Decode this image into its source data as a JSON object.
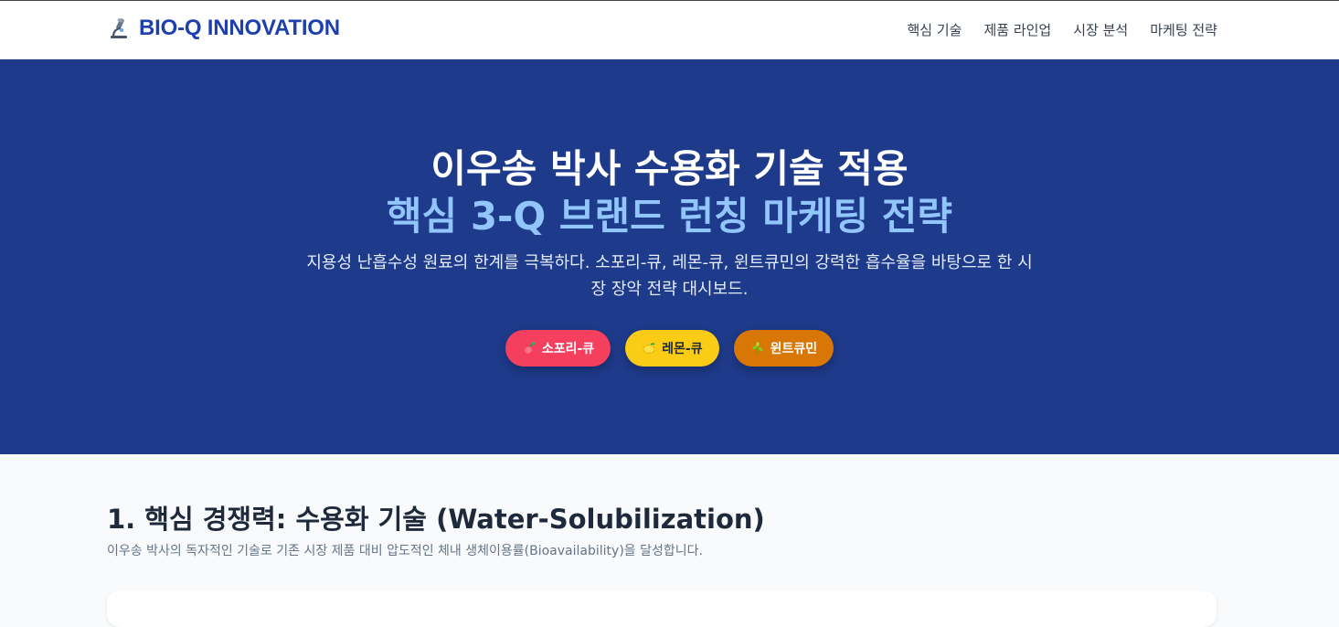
{
  "header": {
    "brand": "BIO-Q INNOVATION",
    "brand_icon": "microscope-icon",
    "nav": [
      "핵심 기술",
      "제품 라인업",
      "시장 분석",
      "마케팅 전략"
    ]
  },
  "hero": {
    "title_line1": "이우송 박사 수용화 기술 적용",
    "title_line2": "핵심 3-Q 브랜드 런칭 마케팅 전략",
    "description": "지용성 난흡수성 원료의 한계를 극복하다. 소포리-큐, 레몬-큐, 윈트큐민의 강력한 흡수율을 바탕으로 한 시장 장악 전략 대시보드.",
    "pills": [
      {
        "label": "소포리-큐",
        "icon": "sophora-icon",
        "bg": "#f43f5e",
        "fg": "#ffffff"
      },
      {
        "label": "레몬-큐",
        "icon": "lemon-icon",
        "bg": "#facc15",
        "fg": "#1f2937"
      },
      {
        "label": "윈트큐민",
        "icon": "herb-icon",
        "bg": "#d97706",
        "fg": "#ffffff"
      }
    ]
  },
  "section": {
    "title": "1. 핵심 경쟁력: 수용화 기술 (Water-Solubilization)",
    "subtitle": "이우송 박사의 독자적인 기술로 기존 시장 제품 대비 압도적인 체내 생체이용률(Bioavailability)을 달성합니다."
  },
  "colors": {
    "brand": "#1e40af",
    "hero_bg": "#1e3a8a",
    "hero_accent": "#93c5fd"
  }
}
